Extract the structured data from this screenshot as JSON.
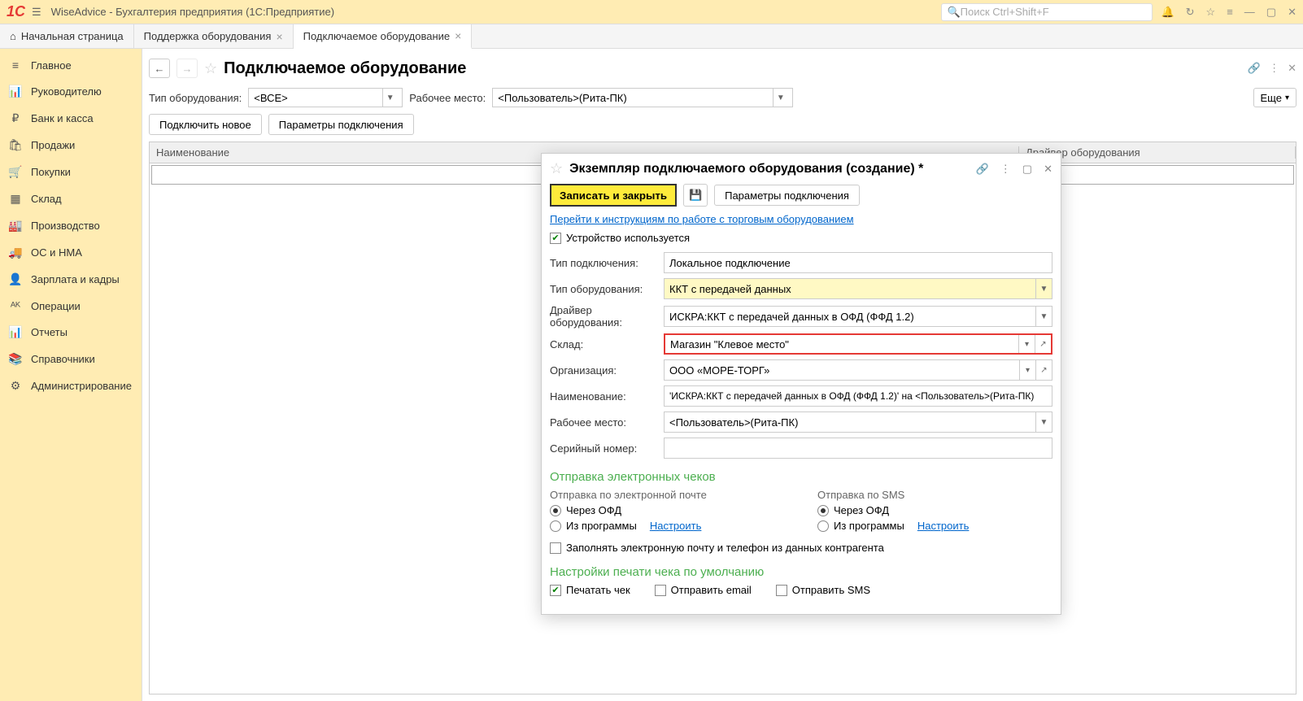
{
  "app": {
    "title": "WiseAdvice - Бухгалтерия предприятия (1С:Предприятие)",
    "search_placeholder": "Поиск Ctrl+Shift+F"
  },
  "tabs": [
    {
      "label": "Начальная страница",
      "closable": false
    },
    {
      "label": "Поддержка оборудования",
      "closable": true
    },
    {
      "label": "Подключаемое оборудование",
      "closable": true,
      "active": true
    }
  ],
  "sidebar": {
    "items": [
      {
        "icon": "≡",
        "label": "Главное"
      },
      {
        "icon": "📊",
        "label": "Руководителю"
      },
      {
        "icon": "₽",
        "label": "Банк и касса"
      },
      {
        "icon": "🛍",
        "label": "Продажи"
      },
      {
        "icon": "🛒",
        "label": "Покупки"
      },
      {
        "icon": "▦",
        "label": "Склад"
      },
      {
        "icon": "🏭",
        "label": "Производство"
      },
      {
        "icon": "🚚",
        "label": "ОС и НМА"
      },
      {
        "icon": "👤",
        "label": "Зарплата и кадры"
      },
      {
        "icon": "ᴬᴷ",
        "label": "Операции"
      },
      {
        "icon": "📊",
        "label": "Отчеты"
      },
      {
        "icon": "📚",
        "label": "Справочники"
      },
      {
        "icon": "⚙",
        "label": "Администрирование"
      }
    ]
  },
  "page": {
    "title": "Подключаемое оборудование",
    "filter_type_label": "Тип оборудования:",
    "filter_type_value": "<ВСЕ>",
    "filter_workplace_label": "Рабочее место:",
    "filter_workplace_value": "<Пользователь>(Рита-ПК)",
    "more_label": "Еще",
    "btn_connect": "Подключить новое",
    "btn_params": "Параметры подключения",
    "col1": "Наименование",
    "col2": "Драйвер оборудования"
  },
  "modal": {
    "title": "Экземпляр подключаемого оборудования (создание) *",
    "btn_save": "Записать и закрыть",
    "btn_params": "Параметры подключения",
    "link_instructions": "Перейти к инструкциям по работе с торговым оборудованием",
    "checkbox_used": "Устройство используется",
    "fields": {
      "conn_type_label": "Тип подключения:",
      "conn_type_value": "Локальное подключение",
      "equip_type_label": "Тип оборудования:",
      "equip_type_value": "ККТ с передачей данных",
      "driver_label": "Драйвер оборудования:",
      "driver_value": "ИСКРА:ККТ с передачей данных в ОФД (ФФД 1.2)",
      "warehouse_label": "Склад:",
      "warehouse_value": "Магазин \"Клевое место\"",
      "org_label": "Организация:",
      "org_value": "ООО «МОРЕ-ТОРГ»",
      "name_label": "Наименование:",
      "name_value": "'ИСКРА:ККТ с передачей данных в ОФД (ФФД 1.2)' на <Пользователь>(Рита-ПК)",
      "workplace_label": "Рабочее место:",
      "workplace_value": "<Пользователь>(Рита-ПК)",
      "serial_label": "Серийный номер:",
      "serial_value": ""
    },
    "section_email": "Отправка электронных чеков",
    "email_sub": "Отправка по электронной почте",
    "sms_sub": "Отправка по SMS",
    "radio_ofd": "Через ОФД",
    "radio_prog": "Из программы",
    "link_config": "Настроить",
    "checkbox_fill": "Заполнять электронную почту и телефон из данных контрагента",
    "section_print": "Настройки печати чека по умолчанию",
    "chk_print": "Печатать чек",
    "chk_email": "Отправить email",
    "chk_sms": "Отправить SMS"
  }
}
